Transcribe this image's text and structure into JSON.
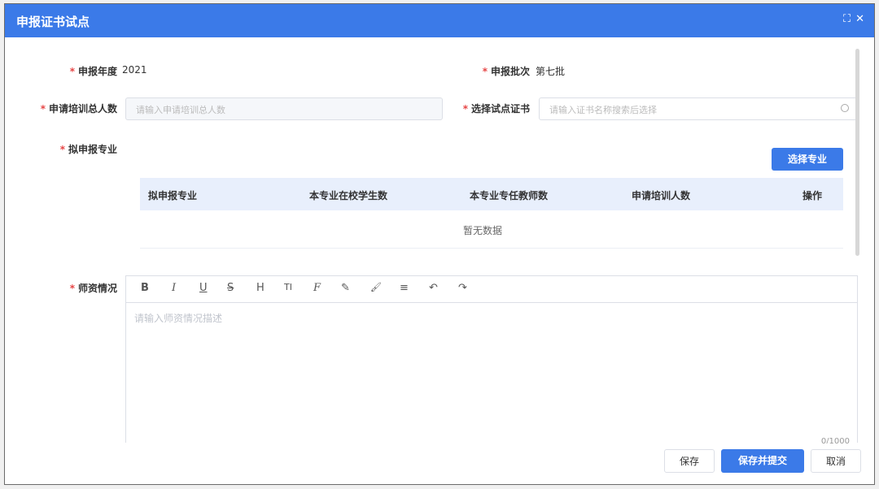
{
  "dialog": {
    "title": "申报证书试点"
  },
  "form": {
    "year": {
      "label": "申报年度",
      "value": "2021"
    },
    "batch": {
      "label": "申报批次",
      "value": "第七批"
    },
    "trainees": {
      "label": "申请培训总人数",
      "placeholder": "请输入申请培训总人数"
    },
    "certificate": {
      "label": "选择试点证书",
      "placeholder": "请输入证书名称搜索后选择"
    },
    "major": {
      "label": "拟申报专业",
      "select_button": "选择专业"
    },
    "table": {
      "columns": [
        "拟申报专业",
        "本专业在校学生数",
        "本专业专任教师数",
        "申请培训人数",
        "操作"
      ],
      "empty_text": "暂无数据"
    },
    "teachers": {
      "label": "师资情况",
      "placeholder": "请输入师资情况描述",
      "counter": "0/1000"
    }
  },
  "toolbar": {
    "bold": "B",
    "italic": "I",
    "underline": "U",
    "strike": "S",
    "heading": "H",
    "font_size": "TI",
    "font": "F",
    "pen": "✎",
    "brush": "🖌",
    "align": "≡",
    "undo": "↶",
    "redo": "↷"
  },
  "icons": {
    "maximize": "maximize-icon",
    "close": "close-icon",
    "search": "search-icon"
  },
  "footer": {
    "save": "保存",
    "save_submit": "保存并提交",
    "cancel": "取消"
  },
  "colors": {
    "primary": "#3b7ae8",
    "required": "#e64545",
    "table_header": "#e8effc"
  }
}
